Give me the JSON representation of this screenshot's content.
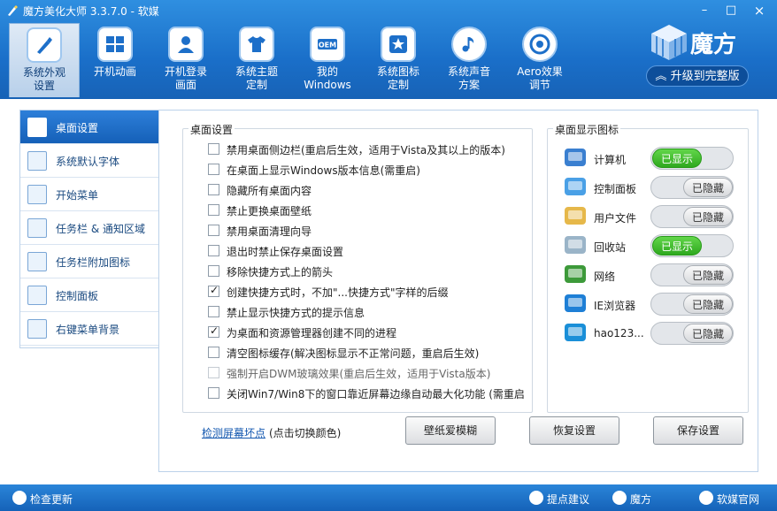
{
  "window": {
    "title": "魔方美化大师 3.3.7.0 - 软媒",
    "min": "–",
    "max": "□",
    "close": "×"
  },
  "toolbar": [
    {
      "line1": "系统外观",
      "line2": "设置",
      "active": true
    },
    {
      "line1": "开机动画",
      "line2": "",
      "active": false
    },
    {
      "line1": "开机登录",
      "line2": "画面",
      "active": false
    },
    {
      "line1": "系统主题",
      "line2": "定制",
      "active": false
    },
    {
      "line1": "我的",
      "line2": "Windows",
      "active": false
    },
    {
      "line1": "系统图标",
      "line2": "定制",
      "active": false
    },
    {
      "line1": "系统声音",
      "line2": "方案",
      "active": false
    },
    {
      "line1": "Aero效果",
      "line2": "调节",
      "active": false
    }
  ],
  "brand": {
    "name": "魔方",
    "upgrade": "升级到完整版",
    "upgrade_icon": "double-chevron-up-icon"
  },
  "sidebar": [
    {
      "label": "桌面设置",
      "icon": "brush-icon",
      "active": true
    },
    {
      "label": "系统默认字体",
      "icon": "font-icon",
      "active": false
    },
    {
      "label": "开始菜单",
      "icon": "start-menu-icon",
      "active": false
    },
    {
      "label": "任务栏 & 通知区域",
      "icon": "taskbar-icon",
      "active": false
    },
    {
      "label": "任务栏附加图标",
      "icon": "taskbar-addon-icon",
      "active": false
    },
    {
      "label": "控制面板",
      "icon": "control-panel-icon",
      "active": false
    },
    {
      "label": "右键菜单背景",
      "icon": "context-menu-bg-icon",
      "active": false
    }
  ],
  "settings": {
    "title": "桌面设置",
    "options": [
      {
        "label": "禁用桌面侧边栏(重启后生效，适用于Vista及其以上的版本)",
        "checked": false,
        "disabled": false
      },
      {
        "label": "在桌面上显示Windows版本信息(需重启)",
        "checked": false,
        "disabled": false
      },
      {
        "label": "隐藏所有桌面内容",
        "checked": false,
        "disabled": false
      },
      {
        "label": "禁止更换桌面壁纸",
        "checked": false,
        "disabled": false
      },
      {
        "label": "禁用桌面清理向导",
        "checked": false,
        "disabled": false
      },
      {
        "label": "退出时禁止保存桌面设置",
        "checked": false,
        "disabled": false
      },
      {
        "label": "移除快捷方式上的箭头",
        "checked": false,
        "disabled": false
      },
      {
        "label": "创建快捷方式时，不加\"...快捷方式\"字样的后缀",
        "checked": true,
        "disabled": false
      },
      {
        "label": "禁止显示快捷方式的提示信息",
        "checked": false,
        "disabled": false
      },
      {
        "label": "为桌面和资源管理器创建不同的进程",
        "checked": true,
        "disabled": false
      },
      {
        "label": "清空图标缓存(解决图标显示不正常问题，重启后生效)",
        "checked": false,
        "disabled": false
      },
      {
        "label": "强制开启DWM玻璃效果(重启后生效，适用于Vista版本)",
        "checked": false,
        "disabled": true
      },
      {
        "label": "关闭Win7/Win8下的窗口靠近屏幕边缘自动最大化功能 (需重启",
        "checked": false,
        "disabled": false
      }
    ]
  },
  "desktop_icons": {
    "title": "桌面显示图标",
    "items": [
      {
        "name": "计算机",
        "icon": "computer-icon",
        "state": "已显示",
        "on": true
      },
      {
        "name": "控制面板",
        "icon": "control-panel-icon",
        "state": "已隐藏",
        "on": false
      },
      {
        "name": "用户文件",
        "icon": "user-folder-icon",
        "state": "已隐藏",
        "on": false
      },
      {
        "name": "回收站",
        "icon": "recycle-bin-icon",
        "state": "已显示",
        "on": true
      },
      {
        "name": "网络",
        "icon": "network-icon",
        "state": "已隐藏",
        "on": false
      },
      {
        "name": "IE浏览器",
        "icon": "ie-browser-icon",
        "state": "已隐藏",
        "on": false
      },
      {
        "name": "hao123...",
        "icon": "hao123-icon",
        "state": "已隐藏",
        "on": false
      }
    ]
  },
  "bottom": {
    "detect_link": "检测屏幕坏点",
    "detect_note": "(点击切换颜色)",
    "buttons": [
      "壁纸爱模糊",
      "恢复设置",
      "保存设置"
    ]
  },
  "statusbar": {
    "check_update": "检查更新",
    "suggest": "提点建议",
    "mofang": "魔方",
    "official": "软媒官网"
  },
  "colors": {
    "accent": "#1a6fc9",
    "on": "#2ea81e",
    "link": "#1458b0"
  }
}
